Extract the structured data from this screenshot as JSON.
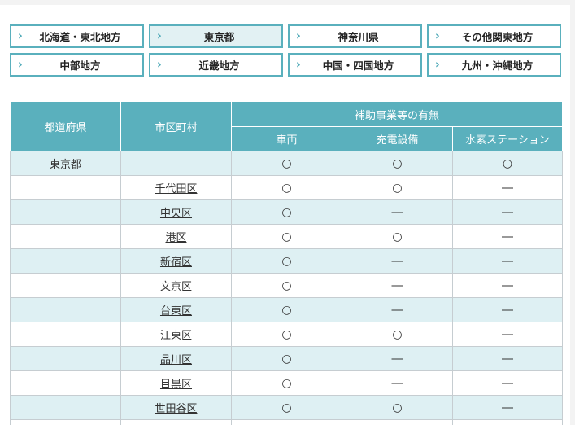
{
  "tabs": [
    {
      "label": "北海道・東北地方",
      "active": false
    },
    {
      "label": "東京都",
      "active": true
    },
    {
      "label": "神奈川県",
      "active": false
    },
    {
      "label": "その他関東地方",
      "active": false
    },
    {
      "label": "中部地方",
      "active": false
    },
    {
      "label": "近畿地方",
      "active": false
    },
    {
      "label": "中国・四国地方",
      "active": false
    },
    {
      "label": "九州・沖縄地方",
      "active": false
    }
  ],
  "table": {
    "headers": {
      "prefecture": "都道府県",
      "city": "市区町村",
      "group": "補助事業等の有無",
      "vehicle": "車両",
      "charging": "充電設備",
      "hydrogen": "水素ステーション"
    },
    "rows": [
      {
        "pref": "東京都",
        "city": "",
        "vehicle": "○",
        "charging": "○",
        "hydrogen": "○"
      },
      {
        "pref": "",
        "city": "千代田区",
        "vehicle": "○",
        "charging": "○",
        "hydrogen": "―"
      },
      {
        "pref": "",
        "city": "中央区",
        "vehicle": "○",
        "charging": "―",
        "hydrogen": "―"
      },
      {
        "pref": "",
        "city": "港区",
        "vehicle": "○",
        "charging": "○",
        "hydrogen": "―"
      },
      {
        "pref": "",
        "city": "新宿区",
        "vehicle": "○",
        "charging": "―",
        "hydrogen": "―"
      },
      {
        "pref": "",
        "city": "文京区",
        "vehicle": "○",
        "charging": "―",
        "hydrogen": "―"
      },
      {
        "pref": "",
        "city": "台東区",
        "vehicle": "○",
        "charging": "―",
        "hydrogen": "―"
      },
      {
        "pref": "",
        "city": "江東区",
        "vehicle": "○",
        "charging": "○",
        "hydrogen": "―"
      },
      {
        "pref": "",
        "city": "品川区",
        "vehicle": "○",
        "charging": "―",
        "hydrogen": "―"
      },
      {
        "pref": "",
        "city": "目黒区",
        "vehicle": "○",
        "charging": "―",
        "hydrogen": "―"
      },
      {
        "pref": "",
        "city": "世田谷区",
        "vehicle": "○",
        "charging": "○",
        "hydrogen": "―"
      },
      {
        "pref": "",
        "city": "",
        "vehicle": "",
        "charging": "",
        "hydrogen": ""
      }
    ]
  },
  "colors": {
    "accent": "#5ab0bd",
    "row_alt": "#def0f3"
  },
  "icons": {
    "tab_chevron": "chevron-right-icon"
  }
}
